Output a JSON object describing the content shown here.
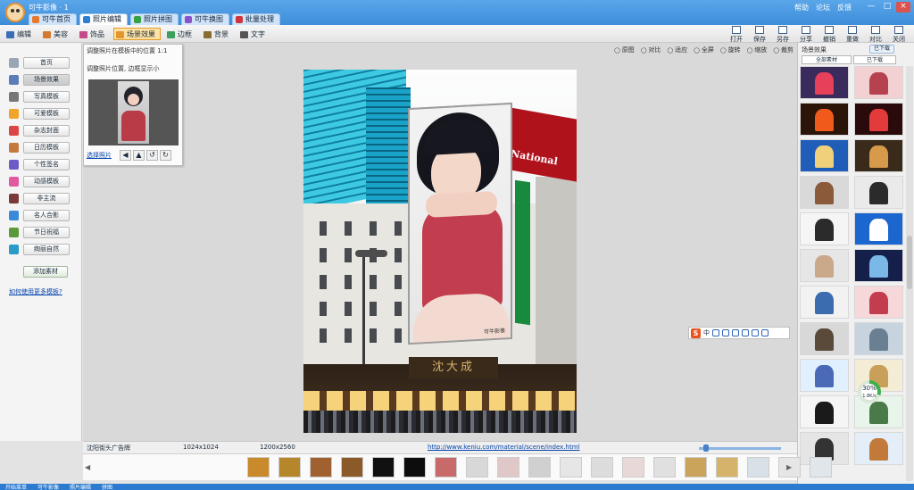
{
  "window": {
    "title": "可牛影像 · 1",
    "tabs": [
      {
        "label": "可牛首页",
        "color": "#e8792a"
      },
      {
        "label": "照片编辑",
        "color": "#2c7fd5",
        "active": true
      },
      {
        "label": "照片拼图",
        "color": "#39a145"
      },
      {
        "label": "可牛换图",
        "color": "#8a52c9"
      },
      {
        "label": "批量处理",
        "color": "#d1333b"
      }
    ],
    "links": [
      "帮助",
      "论坛",
      "反馈"
    ],
    "controls": [
      "—",
      "□",
      "×"
    ]
  },
  "toolbar": {
    "tools": [
      {
        "label": "编辑",
        "color": "#3a6fb8"
      },
      {
        "label": "美容",
        "color": "#d47a2e"
      },
      {
        "label": "饰品",
        "color": "#c54a8a"
      },
      {
        "label": "场景效果",
        "color": "#e2962f",
        "active": true
      },
      {
        "label": "边框",
        "color": "#3aa05c"
      },
      {
        "label": "背景",
        "color": "#8a6d2e"
      },
      {
        "label": "文字",
        "color": "#555555"
      }
    ],
    "right_tools": [
      "打开",
      "保存",
      "另存",
      "分享",
      "撤销",
      "重做",
      "对比",
      "关闭"
    ]
  },
  "left_panel": {
    "items": [
      {
        "label": "首页",
        "color": "#9aa6b3"
      },
      {
        "label": "场景效果",
        "color": "#5a7cb8",
        "active": true
      },
      {
        "label": "写真模板",
        "color": "#777777"
      },
      {
        "label": "可爱模板",
        "color": "#f0a52a"
      },
      {
        "label": "杂志封面",
        "color": "#d44"
      },
      {
        "label": "日历模板",
        "color": "#c47a3d"
      },
      {
        "label": "个性签名",
        "color": "#6b5bc9"
      },
      {
        "label": "动感模板",
        "color": "#e05aa0"
      },
      {
        "label": "非主流",
        "color": "#7a3a3a"
      },
      {
        "label": "名人合影",
        "color": "#3a8ad8"
      },
      {
        "label": "节日祝福",
        "color": "#5a9a3a"
      },
      {
        "label": "绚丽自然",
        "color": "#2a9ac8"
      }
    ],
    "add_button": "添加素材",
    "link": "如何使用更多模板?"
  },
  "popup": {
    "title": "调整照片在模板中的位置 1:1",
    "hint": "调整照片位置, 边框显示小",
    "link": "选择照片",
    "buttons": [
      "◀",
      "▲",
      "↺",
      "↻"
    ]
  },
  "canvas": {
    "view_tools": [
      "原图",
      "对比",
      "适应",
      "全屏",
      "旋转",
      "缩放",
      "裁剪"
    ],
    "photo": {
      "sign_text": "National",
      "shop_text": "沈大成",
      "billboard_tag": "可牛影像"
    },
    "ime": {
      "logo": "S",
      "mode": "中"
    }
  },
  "right_panel": {
    "title": "场景效果",
    "button": "已下载",
    "tabs": [
      "全部素材",
      "已下载"
    ],
    "thumbs": [
      {
        "bg": "#3a2b5c",
        "fg": "#e6405a"
      },
      {
        "bg": "#f3d1d3",
        "fg": "#b6424f"
      },
      {
        "bg": "#2b1508",
        "fg": "#f05a1a"
      },
      {
        "bg": "#2a0a0a",
        "fg": "#e33b3b"
      },
      {
        "bg": "#1f5db8",
        "fg": "#f0d07a"
      },
      {
        "bg": "#3a2a1a",
        "fg": "#d69a4a"
      },
      {
        "bg": "#d9d9d9",
        "fg": "#8a5a3a"
      },
      {
        "bg": "#eaeaea",
        "fg": "#2b2b2b"
      },
      {
        "bg": "#f5f5f5",
        "fg": "#2b2b2b"
      },
      {
        "bg": "#1c66d0",
        "fg": "#ffffff"
      },
      {
        "bg": "#e6e6e6",
        "fg": "#c9a98a"
      },
      {
        "bg": "#14204a",
        "fg": "#7ab8e8"
      },
      {
        "bg": "#f2f2f2",
        "fg": "#3b6cb0"
      },
      {
        "bg": "#f7d8da",
        "fg": "#c23d4e"
      },
      {
        "bg": "#d8d8d8",
        "fg": "#5a4a3a"
      },
      {
        "bg": "#c7d4e0",
        "fg": "#6a7f92"
      },
      {
        "bg": "#e0f0ff",
        "fg": "#4a6ab8"
      },
      {
        "bg": "#f5ecd5",
        "fg": "#c9a05a"
      },
      {
        "bg": "#f5f5f5",
        "fg": "#1a1a1a"
      },
      {
        "bg": "#e8f5ea",
        "fg": "#4a7a4a"
      },
      {
        "bg": "#e5e5e5",
        "fg": "#333333"
      },
      {
        "bg": "#e3eef8",
        "fg": "#c27a3a"
      }
    ],
    "progress": {
      "percent": 30,
      "label": "30%",
      "sub": "1.8K/s"
    }
  },
  "status": {
    "name": "沈阳街头广告牌",
    "size": "1024x1024",
    "dims": "1200x2560",
    "link": "http://www.keniu.com/material/scene/index.html",
    "zoom": 5
  },
  "filmstrip": {
    "items": [
      {
        "bg": "#c98a2c"
      },
      {
        "bg": "#b5862a"
      },
      {
        "bg": "#a06030"
      },
      {
        "bg": "#8a5a28"
      },
      {
        "bg": "#111111"
      },
      {
        "bg": "#0d0d0d"
      },
      {
        "bg": "#c96a6a"
      },
      {
        "bg": "#d8d8d8"
      },
      {
        "bg": "#e0c8c8"
      },
      {
        "bg": "#d0d0d0"
      },
      {
        "bg": "#e6e6e6"
      },
      {
        "bg": "#dcdcdc"
      },
      {
        "bg": "#e8d8d8"
      },
      {
        "bg": "#e0e0e0"
      },
      {
        "bg": "#c9a45a"
      },
      {
        "bg": "#d6b36a"
      },
      {
        "bg": "#d8e0e8"
      },
      {
        "bg": "#e6e6e6"
      },
      {
        "bg": "#e0e6ea"
      }
    ]
  },
  "taskbar": {
    "items": [
      "开始菜单",
      "可牛影像",
      "照片编辑",
      "拼图"
    ]
  }
}
